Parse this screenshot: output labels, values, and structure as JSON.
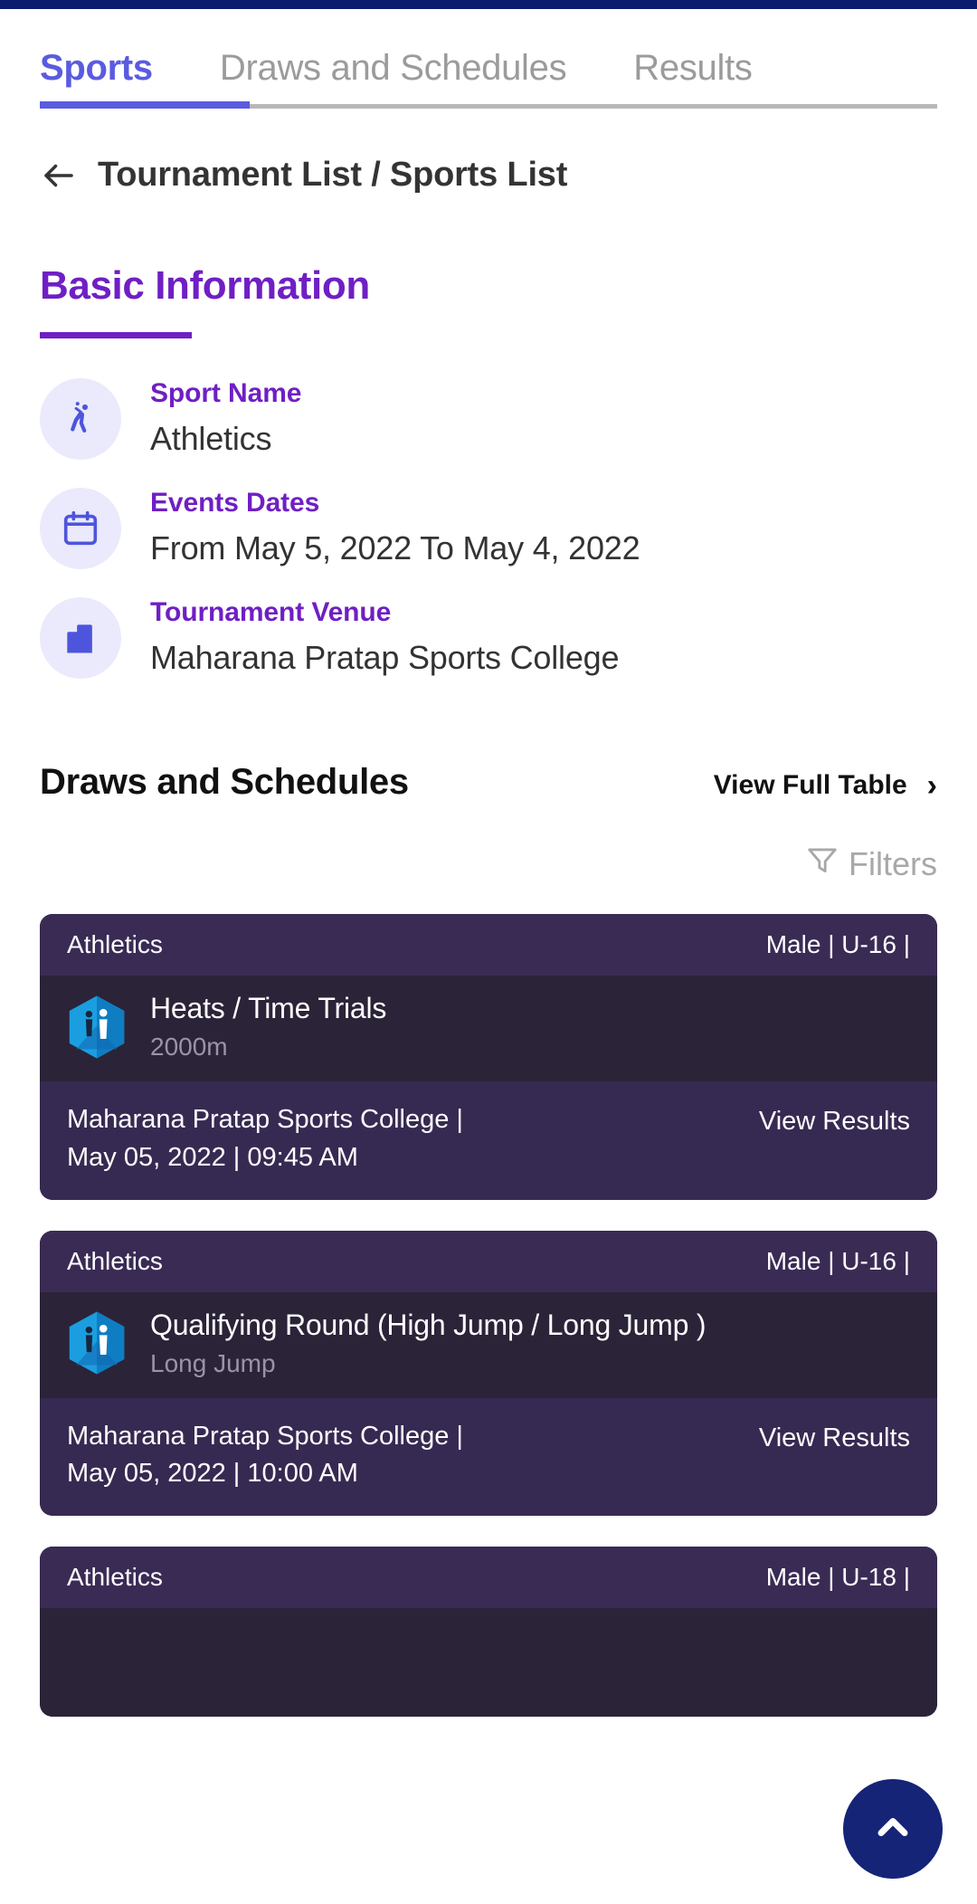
{
  "tabs": [
    {
      "label": "Sports",
      "active": true
    },
    {
      "label": "Draws and Schedules",
      "active": false
    },
    {
      "label": "Results",
      "active": false
    }
  ],
  "breadcrumb": {
    "back_icon": "arrow-left-icon",
    "text": "Tournament List / Sports List"
  },
  "basic_information": {
    "title": "Basic Information",
    "rows": [
      {
        "icon": "athlete-icon",
        "label": "Sport Name",
        "value": "Athletics"
      },
      {
        "icon": "calendar-icon",
        "label": "Events Dates",
        "value": "From May 5, 2022 To May 4, 2022"
      },
      {
        "icon": "building-icon",
        "label": "Tournament Venue",
        "value": "Maharana Pratap Sports College"
      }
    ]
  },
  "draws": {
    "title": "Draws and Schedules",
    "view_full_table": "View Full Table",
    "chevron": "›",
    "filters_label": "Filters",
    "filters_icon": "funnel-icon"
  },
  "cards": [
    {
      "sport": "Athletics",
      "category": "Male | U-16 |",
      "event_name": "Heats / Time Trials",
      "event_sub": "2000m",
      "venue_line": "Maharana Pratap Sports College |",
      "datetime_line": "May 05, 2022 | 09:45 AM",
      "action": "View Results"
    },
    {
      "sport": "Athletics",
      "category": "Male | U-16 |",
      "event_name": "Qualifying Round (High Jump / Long Jump )",
      "event_sub": "Long Jump",
      "venue_line": "Maharana Pratap Sports College |",
      "datetime_line": "May 05, 2022 | 10:00 AM",
      "action": "View Results"
    },
    {
      "sport": "Athletics",
      "category": "Male | U-18 |",
      "event_name": "",
      "event_sub": "",
      "venue_line": "",
      "datetime_line": "",
      "action": ""
    }
  ],
  "fab": {
    "icon": "chevron-up-icon",
    "color": "#152477"
  },
  "colors": {
    "accent_purple": "#6f1fc4",
    "tab_active": "#5b5be0",
    "card_head": "#3a2b55",
    "card_body": "#2b2338",
    "card_foot": "#372a52",
    "status_bar": "#0d1b6e"
  }
}
